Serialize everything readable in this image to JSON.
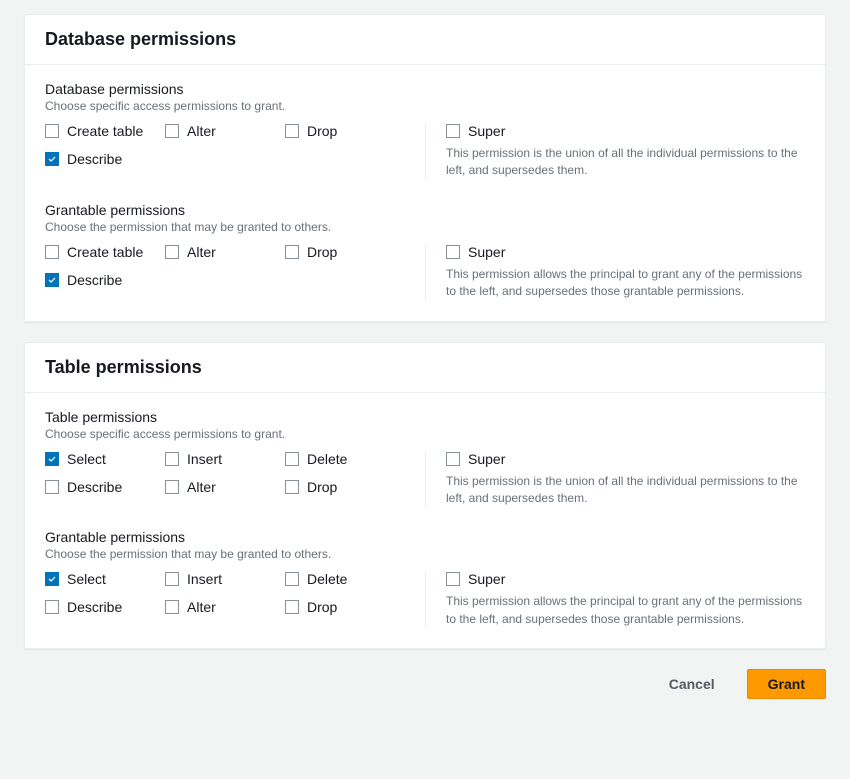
{
  "db_panel": {
    "title": "Database permissions",
    "perm": {
      "title": "Database permissions",
      "hint": "Choose specific access permissions to grant.",
      "items": [
        {
          "label": "Create table",
          "checked": false
        },
        {
          "label": "Alter",
          "checked": false
        },
        {
          "label": "Drop",
          "checked": false
        },
        {
          "label": "Describe",
          "checked": true
        }
      ],
      "super": {
        "label": "Super",
        "checked": false,
        "desc": "This permission is the union of all the individual permissions to the left, and supersedes them."
      }
    },
    "grant": {
      "title": "Grantable permissions",
      "hint": "Choose the permission that may be granted to others.",
      "items": [
        {
          "label": "Create table",
          "checked": false
        },
        {
          "label": "Alter",
          "checked": false
        },
        {
          "label": "Drop",
          "checked": false
        },
        {
          "label": "Describe",
          "checked": true
        }
      ],
      "super": {
        "label": "Super",
        "checked": false,
        "desc": "This permission allows the principal to grant any of the permissions to the left, and supersedes those grantable permissions."
      }
    }
  },
  "tbl_panel": {
    "title": "Table permissions",
    "perm": {
      "title": "Table permissions",
      "hint": "Choose specific access permissions to grant.",
      "items": [
        {
          "label": "Select",
          "checked": true
        },
        {
          "label": "Insert",
          "checked": false
        },
        {
          "label": "Delete",
          "checked": false
        },
        {
          "label": "Describe",
          "checked": false
        },
        {
          "label": "Alter",
          "checked": false
        },
        {
          "label": "Drop",
          "checked": false
        }
      ],
      "super": {
        "label": "Super",
        "checked": false,
        "desc": "This permission is the union of all the individual permissions to the left, and supersedes them."
      }
    },
    "grant": {
      "title": "Grantable permissions",
      "hint": "Choose the permission that may be granted to others.",
      "items": [
        {
          "label": "Select",
          "checked": true
        },
        {
          "label": "Insert",
          "checked": false
        },
        {
          "label": "Delete",
          "checked": false
        },
        {
          "label": "Describe",
          "checked": false
        },
        {
          "label": "Alter",
          "checked": false
        },
        {
          "label": "Drop",
          "checked": false
        }
      ],
      "super": {
        "label": "Super",
        "checked": false,
        "desc": "This permission allows the principal to grant any of the permissions to the left, and supersedes those grantable permissions."
      }
    }
  },
  "footer": {
    "cancel": "Cancel",
    "grant": "Grant"
  }
}
